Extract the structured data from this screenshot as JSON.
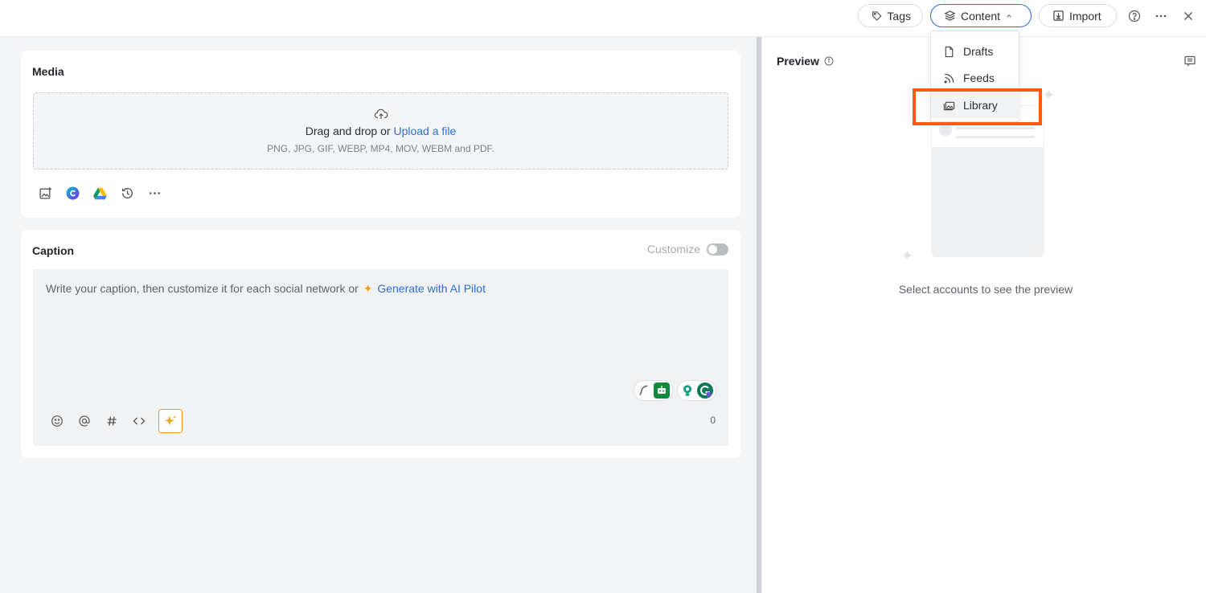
{
  "topbar": {
    "tags_label": "Tags",
    "content_label": "Content",
    "import_label": "Import"
  },
  "content_menu": {
    "items": [
      {
        "label": "Drafts",
        "icon": "file-icon"
      },
      {
        "label": "Feeds",
        "icon": "rss-icon"
      },
      {
        "label": "Library",
        "icon": "library-icon"
      }
    ]
  },
  "media": {
    "title": "Media",
    "drop_text": "Drag and drop or",
    "upload_link": "Upload a file",
    "formats": "PNG, JPG, GIF, WEBP, MP4, MOV, WEBM and PDF."
  },
  "caption": {
    "title": "Caption",
    "customize_label": "Customize",
    "placeholder": "Write your caption, then customize it for each social network or",
    "ai_link": "Generate with AI Pilot",
    "char_count": "0"
  },
  "preview": {
    "title": "Preview",
    "empty_text": "Select accounts to see the preview"
  },
  "colors": {
    "accent": "#2a6fd8",
    "highlight": "#ff5c0f",
    "ai": "#f0a01f"
  }
}
